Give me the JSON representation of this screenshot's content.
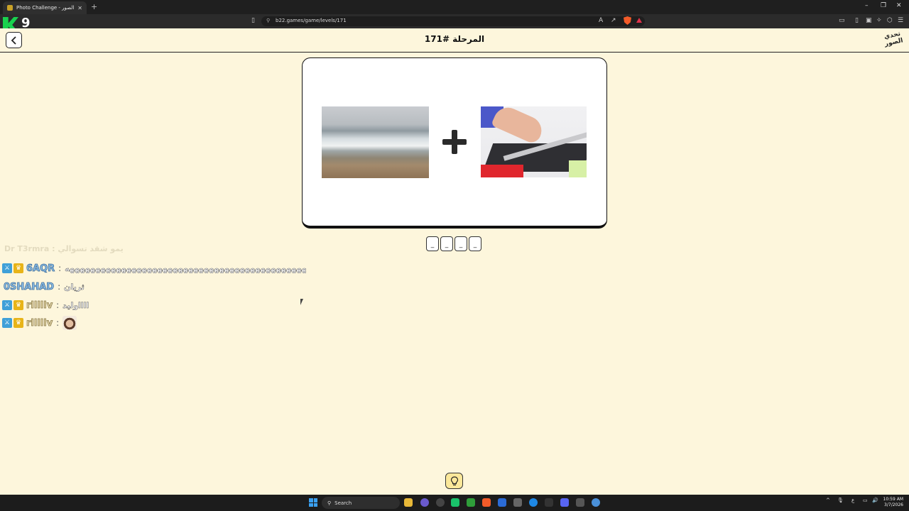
{
  "browser": {
    "tab_title": "Photo Challenge - تحدي الصور",
    "url": "b22.games/game/levels/171",
    "new_tab_symbol": "+",
    "tab_close_symbol": "✕"
  },
  "overlay": {
    "logo_number": "9"
  },
  "header": {
    "level_title": "المرحلة #171",
    "logo_text": "تحدي الصور"
  },
  "puzzle": {
    "images": [
      "sea-waves-photo",
      "tile-cutter-photo"
    ],
    "operator": "plus-icon",
    "slots": [
      "_",
      "_",
      "_",
      "_"
    ]
  },
  "chat": {
    "faded_line": "Dr T3rmra : يمو شقد تسوالي",
    "lines": [
      {
        "user": "6AQR",
        "message": "هههههههههههههههههههههههههههههههههههههههههههههههههههههههه",
        "badges": true,
        "style": "blue"
      },
      {
        "user": "0SHAHAD",
        "message": "ثريان",
        "badges": false,
        "style": "blue"
      },
      {
        "user": "rlllllv",
        "message": "ااااوليد",
        "badges": true,
        "style": "gold"
      },
      {
        "user": "rlllllv",
        "message": "",
        "badges": true,
        "style": "gold",
        "emote": true
      }
    ]
  },
  "taskbar": {
    "search_label": "Search",
    "time": "10:59 AM",
    "date": "3/7/2026",
    "lang": "ع"
  },
  "colors": {
    "page_background": "#fdf6dc",
    "accent_green": "#19d24e",
    "hint_yellow": "#fbe89a"
  }
}
